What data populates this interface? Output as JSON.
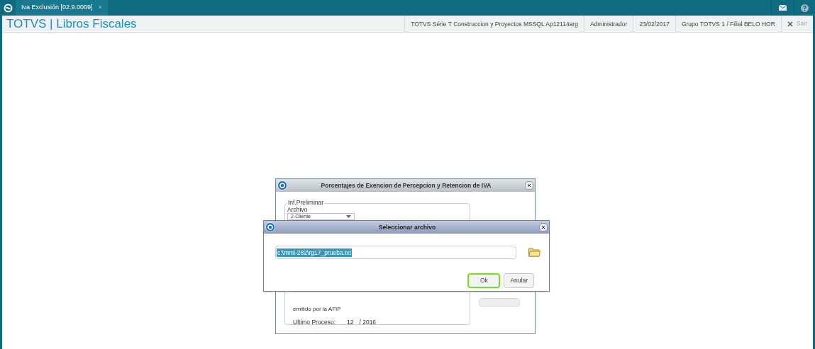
{
  "top_bar": {
    "tabs": [
      {
        "label": "Iva Exclusión [02.9.0009]",
        "close": "×",
        "selected": true
      }
    ]
  },
  "header": {
    "title": "TOTVS | Libros Fiscales",
    "info": [
      "TOTVS Série T Construccion y Proyectos MSSQL Ap12114arg",
      "Administrador",
      "23/02/2017",
      "Grupo TOTVS 1 / Filial BELO HOR"
    ],
    "exit": "Sair"
  },
  "back_dialog": {
    "title": "Porcentajes de Exencion de Percepcion y Retencion de IVA",
    "group": "Inf.Preliminar",
    "archivo_label": "Archivo",
    "archivo_value": "2-Cliente",
    "note": "emitido por la AFIP",
    "last_label": "Ultimo Proceso:",
    "last_month": "12",
    "last_year": "/ 2016"
  },
  "file_dialog": {
    "title": "Seleccionar archivo",
    "path": "c:\\mmi-282\\rg17_prueba.txt",
    "buttons": [
      {
        "label": "Ok",
        "focused": true
      },
      {
        "label": "Anular",
        "focused": false
      }
    ]
  }
}
